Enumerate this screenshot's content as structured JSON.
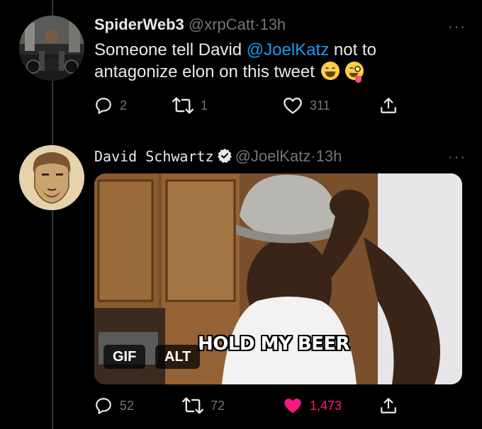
{
  "tweet1": {
    "display_name": "SpiderWeb3",
    "handle": "@xrpCatt",
    "separator": "·",
    "time": "13h",
    "text_before": "Someone tell David ",
    "mention": "@JoelKatz",
    "text_after": " not to antagonize elon on this tweet ",
    "emojis": [
      "grinning-squinting-face",
      "winking-face-with-tongue"
    ],
    "replies": "2",
    "retweets": "1",
    "likes": "311",
    "more": "···"
  },
  "tweet2": {
    "display_name": "David Schwartz",
    "verified": true,
    "handle": "@JoelKatz",
    "separator": "·",
    "time": "13h",
    "media": {
      "caption": "HOLD MY BEER",
      "gif_label": "GIF",
      "alt_label": "ALT"
    },
    "replies": "52",
    "retweets": "72",
    "likes": "1,473",
    "liked": true,
    "more": "···"
  },
  "colors": {
    "background": "#000000",
    "text": "#e7e9ea",
    "muted": "#71767b",
    "link": "#1d9bf0",
    "like_active": "#f91880",
    "thread_line": "#333639"
  },
  "icons": [
    "reply-icon",
    "retweet-icon",
    "like-icon",
    "share-icon",
    "verified-badge-icon",
    "more-icon"
  ]
}
